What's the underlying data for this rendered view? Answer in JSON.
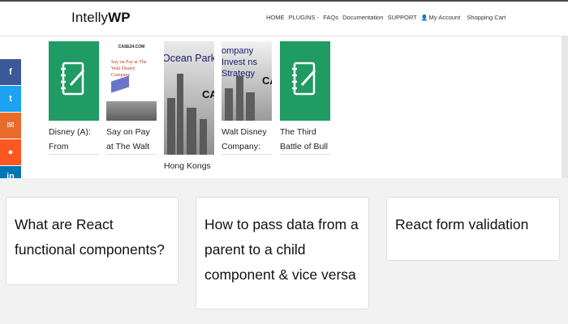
{
  "header": {
    "logo_prefix": "Intelly",
    "logo_suffix": "WP",
    "nav": [
      {
        "label": "HOME"
      },
      {
        "label": "PLUGINS -"
      },
      {
        "label": "FAQs"
      },
      {
        "label": "Documentation"
      },
      {
        "label": "SUPPORT"
      },
      {
        "label": "My Account",
        "icon": "user-icon"
      },
      {
        "label": "Shopping Cart"
      }
    ]
  },
  "books": [
    {
      "title": "Disney (A): From",
      "cover": "notebook-icon"
    },
    {
      "title": "Say on Pay at The Walt",
      "cover_caption": "Say on Pay at The Walt Disney Company",
      "cover_brand": "CASE24.COM"
    },
    {
      "title": "Hong Kongs",
      "cover_caption": "Ocean Park Tal",
      "cover_mark": "CAS"
    },
    {
      "title": "Walt Disney Company:",
      "cover_caption": "ompany Invest ns Strategy",
      "cover_mark": "CAS"
    },
    {
      "title": "The Third Battle of Bull Run: The",
      "cover": "notebook-icon"
    }
  ],
  "share": [
    {
      "icon": "facebook-icon",
      "glyph": "f",
      "color": "#3b5998"
    },
    {
      "icon": "twitter-icon",
      "glyph": "t",
      "color": "#1da1f2"
    },
    {
      "icon": "email-icon",
      "glyph": "✉",
      "color": "#e86b2b"
    },
    {
      "icon": "reddit-icon",
      "glyph": "●",
      "color": "#ff5722"
    },
    {
      "icon": "linkedin-icon",
      "glyph": "in",
      "color": "#0077b5"
    }
  ],
  "cards": [
    {
      "title": "What are React functional components?"
    },
    {
      "title": "How to pass data from a parent to a child component & vice versa"
    },
    {
      "title": "React form validation"
    }
  ]
}
